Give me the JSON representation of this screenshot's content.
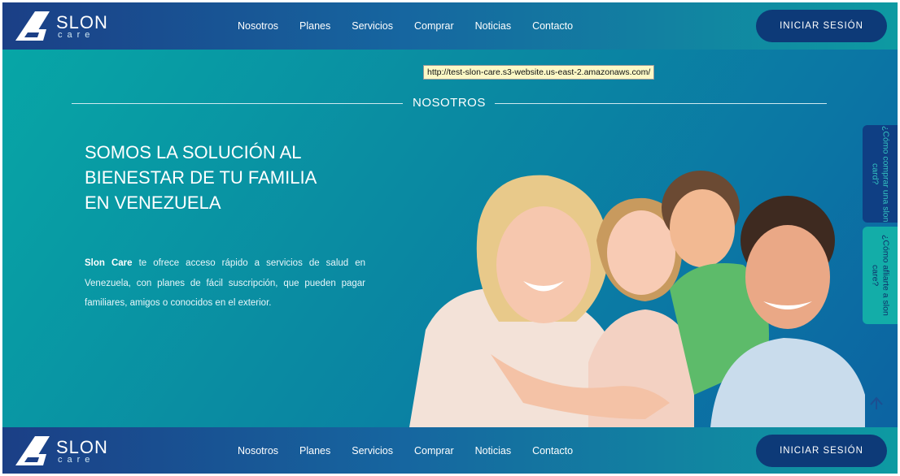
{
  "brand": {
    "name": "SLON",
    "sub": "care"
  },
  "nav": [
    "Nosotros",
    "Planes",
    "Servicios",
    "Comprar",
    "Noticias",
    "Contacto"
  ],
  "login_label": "INICIAR SESIÓN",
  "tooltip": "http://test-slon-care.s3-website.us-east-2.amazonaws.com/",
  "section_title": "NOSOTROS",
  "headline": [
    "SOMOS LA SOLUCIÓN AL",
    "BIENESTAR DE TU FAMILIA",
    "EN VENEZUELA"
  ],
  "body": {
    "brand": "Slon Care",
    "text": " te ofrece acceso rápido a servicios de salud en Venezuela, con planes de fácil suscripción, que pueden pagar familiares, amigos o conocidos en el exterior."
  },
  "side_tabs": [
    "¿Cómo comprar una slon card?",
    "¿Cómo afliarte a slon care?"
  ],
  "colors": {
    "navy": "#0d3a78",
    "teal": "#0aa3a6",
    "tab_dark": "#0f3f84",
    "tab_teal": "#13ada8"
  }
}
